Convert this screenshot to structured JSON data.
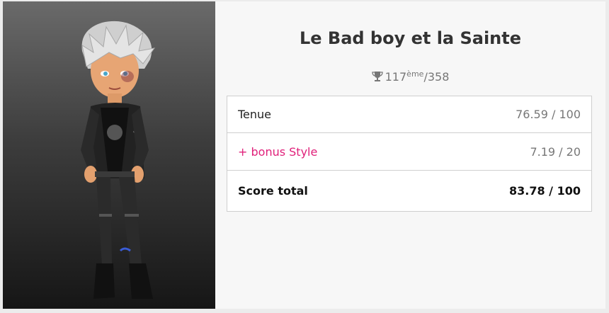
{
  "look": {
    "title": "Le Bad boy et la Sainte",
    "rank": {
      "position": "117",
      "suffix": "ème",
      "total": "/358"
    }
  },
  "scores": [
    {
      "label": "Tenue",
      "value": "76.59 / 100"
    },
    {
      "label": "+ bonus Style",
      "value": "7.19 / 20"
    },
    {
      "label": "Score total",
      "value": "83.78 / 100"
    }
  ],
  "colors": {
    "bonus": "#e0207a",
    "panel_background_top": "#6a6a6a",
    "panel_background_bottom": "#161616"
  },
  "icons": {
    "rank": "trophy-icon"
  }
}
